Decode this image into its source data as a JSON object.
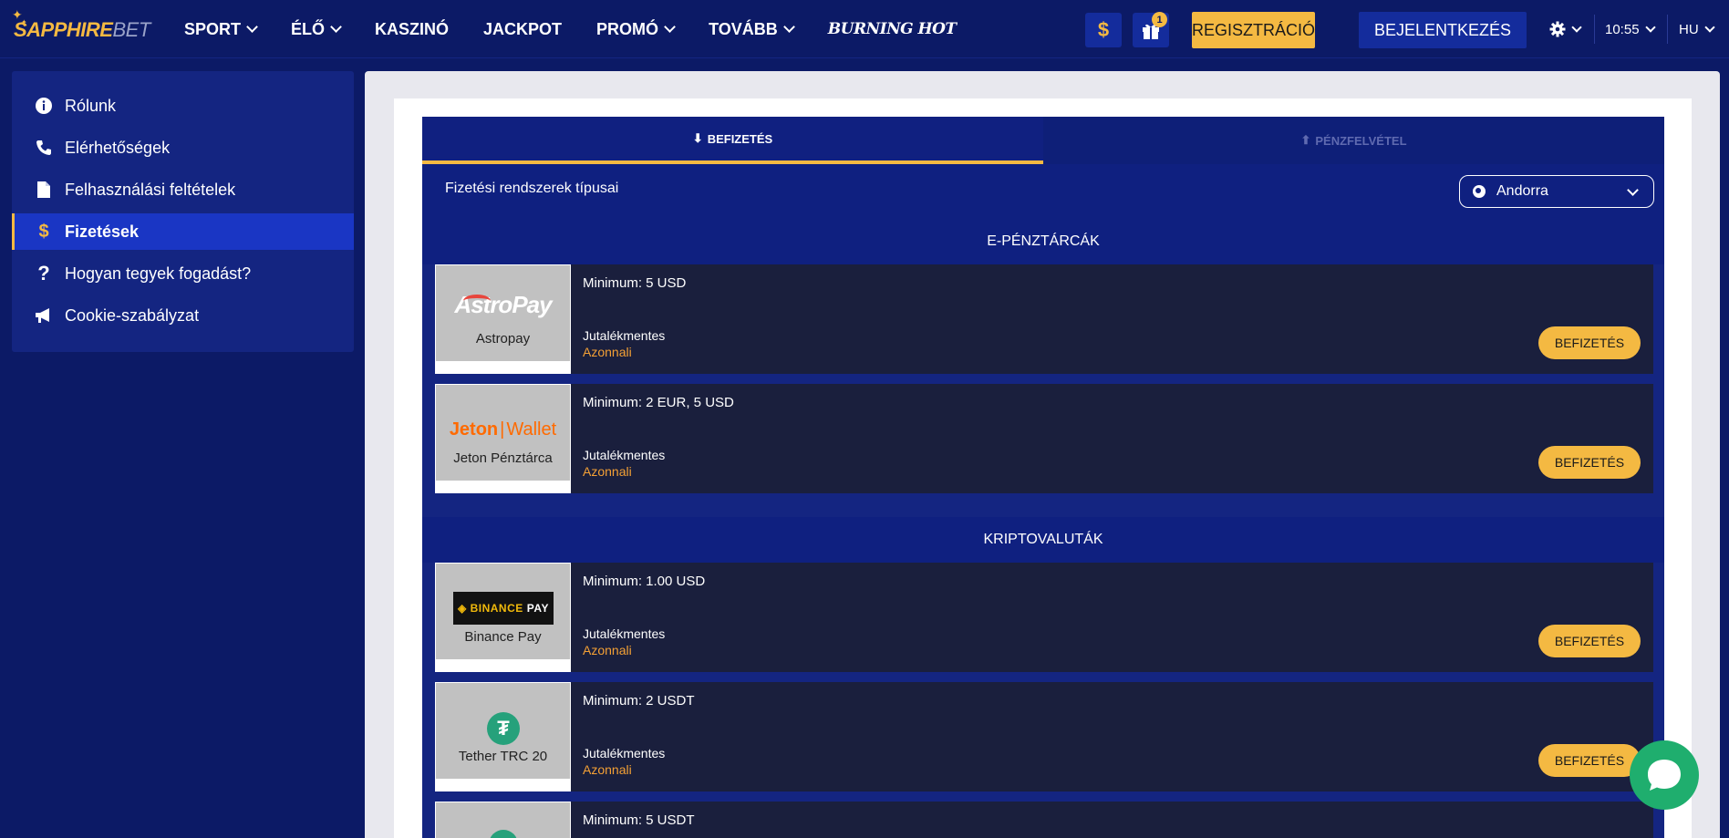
{
  "brand": {
    "part1": "SAPPHIRE",
    "part2": "BET"
  },
  "nav": {
    "items": [
      {
        "label": "SPORT",
        "dropdown": true
      },
      {
        "label": "ÉLŐ",
        "dropdown": true
      },
      {
        "label": "KASZINÓ",
        "dropdown": false
      },
      {
        "label": "JACKPOT",
        "dropdown": false
      },
      {
        "label": "PROMÓ",
        "dropdown": true
      },
      {
        "label": "TOVÁBB",
        "dropdown": true
      }
    ],
    "promo_text": "BURNING HOT"
  },
  "header": {
    "gift_count": "1",
    "register_label": "REGISZTRÁCIÓ",
    "login_label": "BEJELENTKEZÉS",
    "time": "10:55",
    "language": "HU",
    "dollar_symbol": "$"
  },
  "sidebar": {
    "items": [
      {
        "label": "Rólunk",
        "icon": "info-icon"
      },
      {
        "label": "Elérhetőségek",
        "icon": "phone-icon"
      },
      {
        "label": "Felhasználási feltételek",
        "icon": "document-icon"
      },
      {
        "label": "Fizetések",
        "icon": "dollar-icon",
        "active": true
      },
      {
        "label": "Hogyan tegyek fogadást?",
        "icon": "question-icon"
      },
      {
        "label": "Cookie-szabályzat",
        "icon": "megaphone-icon"
      }
    ]
  },
  "tabs": {
    "deposit": "BEFIZETÉS",
    "withdraw": "PÉNZFELVÉTEL"
  },
  "filter": {
    "label": "Fizetési rendszerek típusai",
    "country": "Andorra"
  },
  "sections": {
    "ewallets": {
      "title": "E-PÉNZTÁRCÁK",
      "methods": [
        {
          "name": "Astropay",
          "logo_text": "AstroPay",
          "minimum": "Minimum: 5 USD",
          "fee": "Jutalékmentes",
          "speed": "Azonnali",
          "button": "BEFIZETÉS"
        },
        {
          "name": "Jeton Pénztárca",
          "logo_text_1": "Jeton",
          "logo_text_2": "Wallet",
          "minimum": "Minimum: 2 EUR, 5 USD",
          "fee": "Jutalékmentes",
          "speed": "Azonnali",
          "button": "BEFIZETÉS"
        }
      ]
    },
    "crypto": {
      "title": "KRIPTOVALUTÁK",
      "methods": [
        {
          "name": "Binance Pay",
          "logo_text_1": "◈ BINANCE",
          "logo_text_2": "PAY",
          "minimum": "Minimum: 1.00 USD",
          "fee": "Jutalékmentes",
          "speed": "Azonnali",
          "button": "BEFIZETÉS"
        },
        {
          "name": "Tether TRC 20",
          "logo_text": "₮",
          "minimum": "Minimum: 2 USDT",
          "fee": "Jutalékmentes",
          "speed": "Azonnali",
          "button": "BEFIZETÉS"
        },
        {
          "minimum": "Minimum: 5 USDT"
        }
      ]
    }
  },
  "colors": {
    "accent": "#f4b942",
    "background": "#0c1a66",
    "panel": "#142581",
    "method_row": "#1a1f3d",
    "speed_text": "#f4a035"
  }
}
